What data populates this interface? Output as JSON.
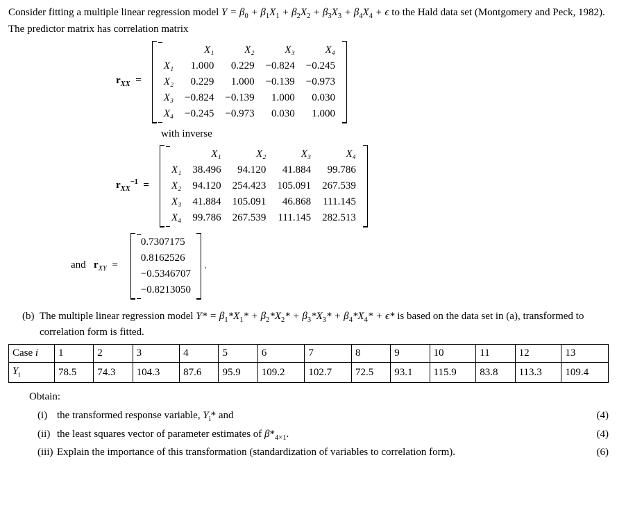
{
  "intro_1": "Consider fitting a multiple linear regression model ",
  "intro_eq": "Y = β₀ + β₁X₁ + β₂X₂ + β₃X₃ + β₄X₄ + ϵ",
  "intro_2": " to the Hald data set (Montgomery and Peck, 1982). The predictor matrix has correlation matrix",
  "rxx_label": "r",
  "rxx_sub": "XX",
  "eq_sign": "=",
  "headers": [
    "X₁",
    "X₂",
    "X₃",
    "X₄"
  ],
  "rxx": {
    "rows": [
      [
        "X₁",
        "1.000",
        "0.229",
        "−0.824",
        "−0.245"
      ],
      [
        "X₂",
        "0.229",
        "1.000",
        "−0.139",
        "−0.973"
      ],
      [
        "X₃",
        "−0.824",
        "−0.139",
        "1.000",
        "0.030"
      ],
      [
        "X₄",
        "−0.245",
        "−0.973",
        "0.030",
        "1.000"
      ]
    ]
  },
  "with_inverse": "with inverse",
  "rxxinv_label_sup": "−1",
  "rxxinv": {
    "rows": [
      [
        "X₁",
        "38.496",
        "94.120",
        "41.884",
        "99.786"
      ],
      [
        "X₂",
        "94.120",
        "254.423",
        "105.091",
        "267.539"
      ],
      [
        "X₃",
        "41.884",
        "105.091",
        "46.868",
        "111.145"
      ],
      [
        "X₄",
        "99.786",
        "267.539",
        "111.145",
        "282.513"
      ]
    ]
  },
  "and_text": "and",
  "rxy_sub": "XY",
  "rxy": [
    "0.7307175",
    "0.8162526",
    "−0.5346707",
    "−0.8213050"
  ],
  "part_b_marker": "(b)",
  "part_b_text_1": "The multiple linear regression model ",
  "part_b_eq": "Y* = β₁*X₁* + β₂*X₂* + β₃*X₃* + β₄*X₄* + ϵ*",
  "part_b_text_2": " is based on the data set in (a), transformed to correlation form is fitted.",
  "table_header_label": "Case i",
  "table_row_label": "Yᵢ",
  "cases": [
    "1",
    "2",
    "3",
    "4",
    "5",
    "6",
    "7",
    "8",
    "9",
    "10",
    "11",
    "12",
    "13"
  ],
  "Y": [
    "78.5",
    "74.3",
    "104.3",
    "87.6",
    "95.9",
    "109.2",
    "102.7",
    "72.5",
    "93.1",
    "115.9",
    "83.8",
    "113.3",
    "109.4"
  ],
  "obtain": "Obtain:",
  "items": [
    {
      "marker": "(i)",
      "text": "the transformed response variable, Yᵢ* and",
      "marks": "(4)"
    },
    {
      "marker": "(ii)",
      "text": "the least squares vector of parameter estimates of β*₄ₓ₁.",
      "marks": "(4)"
    },
    {
      "marker": "(iii)",
      "text": "Explain the importance of this transformation (standardization of variables to correlation form).",
      "marks": "(6)"
    }
  ],
  "chart_data": {
    "type": "table",
    "title": "Hald data Y values by Case i",
    "categories": [
      "1",
      "2",
      "3",
      "4",
      "5",
      "6",
      "7",
      "8",
      "9",
      "10",
      "11",
      "12",
      "13"
    ],
    "values": [
      78.5,
      74.3,
      104.3,
      87.6,
      95.9,
      109.2,
      102.7,
      72.5,
      93.1,
      115.9,
      83.8,
      113.3,
      109.4
    ]
  }
}
